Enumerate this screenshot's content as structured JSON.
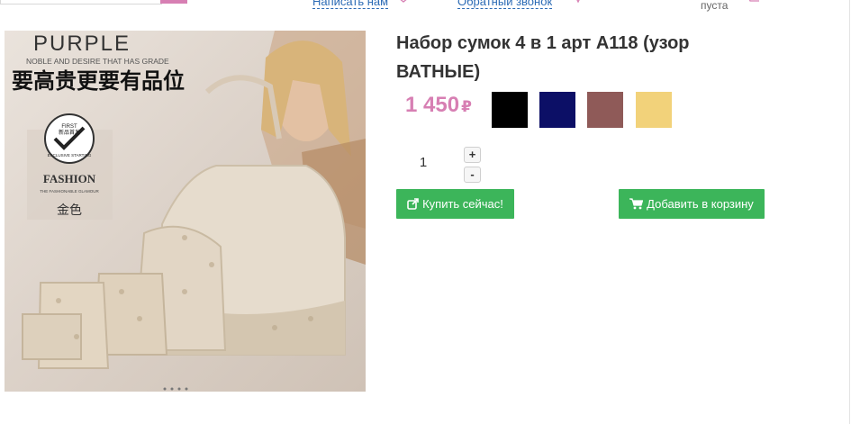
{
  "header": {
    "write_us_label": "Написать нам",
    "callback_label": "Обратный звонок",
    "cart_status": "пуста"
  },
  "product": {
    "title": "Набор сумок 4 в 1 арт А118 (узор ВАТНЫЕ)",
    "price": "1 450",
    "currency": "₽",
    "image_text": {
      "brand": "PURPLE",
      "tagline": "NOBLE AND DESIRE THAT HAS GRADE",
      "chinese_headline": "要高贵更要有品位",
      "badge_top": "FIRST",
      "badge_mid": "新品首发",
      "badge_ribbon": "EXCLUSIVE STARTING",
      "fashion": "FASHION",
      "fashion_sub": "THE FASHIONABLE GLAMOUR",
      "gold_color": "金色"
    },
    "colors": [
      {
        "name": "black",
        "hex": "#000000"
      },
      {
        "name": "navy",
        "hex": "#0c0f66"
      },
      {
        "name": "dusty-rose",
        "hex": "#8f5a58"
      },
      {
        "name": "sand-yellow",
        "hex": "#f2d27a"
      }
    ],
    "quantity": "1",
    "qty_plus": "+",
    "qty_minus": "-"
  },
  "actions": {
    "buy_now_label": "Купить сейчас!",
    "add_to_cart_label": "Добавить в корзину"
  },
  "theme": {
    "accent": "#d77fb3",
    "button_green": "#3cb55a",
    "link_blue": "#2c6bb5"
  }
}
